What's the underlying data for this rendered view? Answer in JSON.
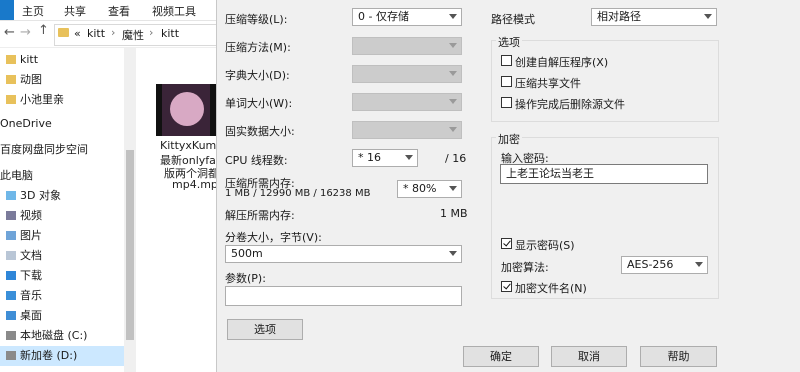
{
  "explorer": {
    "ribbon_tabs": [
      "主页",
      "共享",
      "查看",
      "视频工具"
    ],
    "breadcrumb": [
      "kitt",
      "魔性",
      "kitt"
    ],
    "breadcrumb_prefix": "«",
    "nav_items": [
      {
        "label": "kitt",
        "icon": "folder-icon"
      },
      {
        "label": "动图",
        "icon": "folder-icon"
      },
      {
        "label": "小池里亲",
        "icon": "folder-icon"
      },
      {
        "label": "OneDrive",
        "icon": "cloud-icon"
      },
      {
        "label": "百度网盘同步空间",
        "icon": "cloud-icon"
      },
      {
        "label": "此电脑",
        "icon": "computer-icon"
      },
      {
        "label": "3D 对象",
        "icon": "cube-icon"
      },
      {
        "label": "视频",
        "icon": "video-icon"
      },
      {
        "label": "图片",
        "icon": "picture-icon"
      },
      {
        "label": "文档",
        "icon": "document-icon"
      },
      {
        "label": "下载",
        "icon": "download-icon"
      },
      {
        "label": "音乐",
        "icon": "music-icon"
      },
      {
        "label": "桌面",
        "icon": "desktop-icon"
      },
      {
        "label": "本地磁盘 (C:)",
        "icon": "drive-icon"
      },
      {
        "label": "新加卷 (D:)",
        "icon": "drive-icon"
      }
    ],
    "file_name_lines": [
      "KittyxKum0...",
      "最新onlyfan",
      "版两个洞都",
      "mp4.mp4"
    ]
  },
  "dialog": {
    "compression_level": {
      "label": "压缩等级(L):",
      "value": "0 - 仅存储"
    },
    "compression_method": {
      "label": "压缩方法(M):"
    },
    "dictionary_size": {
      "label": "字典大小(D):"
    },
    "word_size": {
      "label": "单词大小(W):"
    },
    "solid_block": {
      "label": "固实数据大小:"
    },
    "cpu_threads": {
      "label": "CPU 线程数:",
      "value": "* 16",
      "max": "/ 16"
    },
    "memory_compress": {
      "label": "压缩所需内存:",
      "detail": "1 MB / 12990 MB / 16238 MB",
      "value": "* 80%"
    },
    "memory_decompress": {
      "label": "解压所需内存:",
      "value": "1 MB"
    },
    "split_volume": {
      "label": "分卷大小，字节(V):",
      "value": "500m"
    },
    "parameters": {
      "label": "参数(P):",
      "value": ""
    },
    "options_button": "选项",
    "path_mode": {
      "label": "路径模式",
      "value": "相对路径"
    },
    "options_group": {
      "title": "选项",
      "items": [
        {
          "label": "创建自解压程序(X)",
          "checked": false
        },
        {
          "label": "压缩共享文件",
          "checked": false
        },
        {
          "label": "操作完成后删除源文件",
          "checked": false
        }
      ]
    },
    "encryption": {
      "title": "加密",
      "password_label": "输入密码:",
      "password_value": "上老王论坛当老王",
      "show_password": {
        "label": "显示密码(S)",
        "checked": true
      },
      "method_label": "加密算法:",
      "method_value": "AES-256",
      "encrypt_names": {
        "label": "加密文件名(N)",
        "checked": true
      }
    },
    "buttons": {
      "ok": "确定",
      "cancel": "取消",
      "help": "帮助"
    }
  }
}
